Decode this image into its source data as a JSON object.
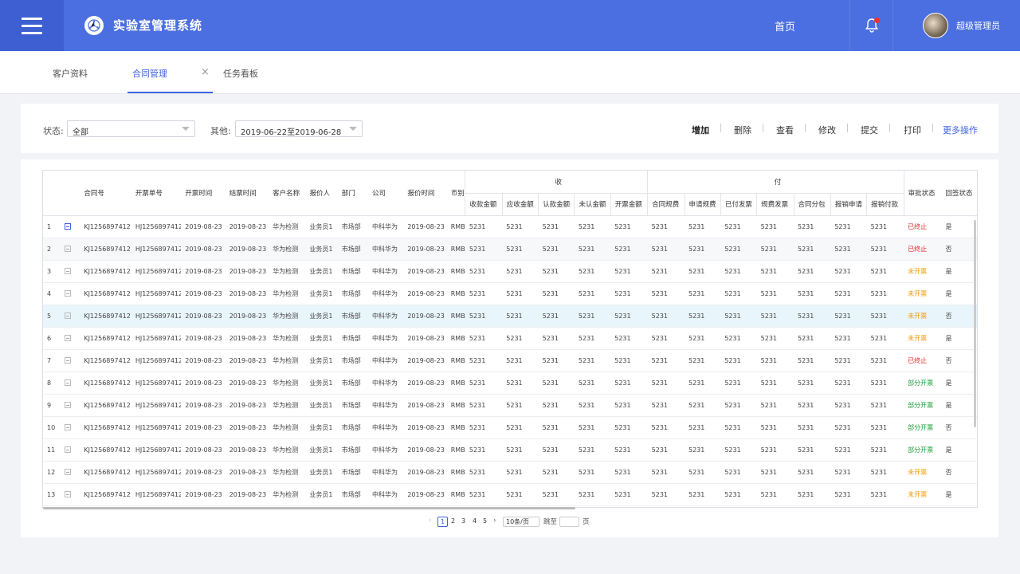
{
  "header": {
    "app_title": "实验室管理系统",
    "home_label": "首页",
    "notification_count": "3",
    "user_name": "超级管理员",
    "accent": "#4b6fe0"
  },
  "tabs": [
    {
      "label": "客户资料"
    },
    {
      "label": "合同管理"
    },
    {
      "label": "任务看板"
    }
  ],
  "filters": {
    "status_label": "状态:",
    "status_value": "全部",
    "other_label": "其他:",
    "date_range": "2019-06-22至2019-06-28"
  },
  "actions": {
    "add": "增加",
    "delete": "删除",
    "view": "查看",
    "edit": "修改",
    "submit": "提交",
    "print": "打印",
    "more": "更多操作"
  },
  "table": {
    "group_receive": "收",
    "group_pay": "付",
    "columns": {
      "contract_no": "合同号",
      "invoice_no": "开票单号",
      "open_time": "开票时间",
      "close_time": "结票时间",
      "customer": "客户名称",
      "reporter": "报价人",
      "dept": "部门",
      "company": "公司",
      "quote_time": "报价时间",
      "currency": "币别",
      "recv_amount": "收款金额",
      "due_amount": "应收金额",
      "confirm_amount": "认款金额",
      "unconfirm_amount": "未认金额",
      "invoice_amount": "开票金额",
      "contract_fee": "合同规费",
      "apply_fee": "申请规费",
      "paid_invoice": "已付发票",
      "fee_invoice": "规费发票",
      "contract_split": "合同分包",
      "reimburse_apply": "报销申请",
      "reimburse_pay": "报销付款",
      "approval": "审批状态",
      "return_status": "回签状态"
    },
    "rows": [
      {
        "n": "1",
        "c1": "KJ1256897412",
        "c2": "HJ1256897412",
        "c3": "2019-08-23",
        "c4": "2019-08-23",
        "c5": "华为检测",
        "c6": "业务员1",
        "c7": "市场部",
        "c8": "中科华为",
        "c9": "2019-08-23",
        "c10": "RMB",
        "v1": "5231",
        "v2": "5231",
        "v3": "5231",
        "v4": "5231",
        "v5": "5231",
        "p1": "5231",
        "p2": "5231",
        "p3": "5231",
        "p4": "5231",
        "p5": "5231",
        "p6": "5231",
        "p7": "5231",
        "status": "已终止",
        "ret": "是"
      },
      {
        "n": "2",
        "c1": "KJ1256897412",
        "c2": "HJ1256897412",
        "c3": "2019-08-23",
        "c4": "2019-08-23",
        "c5": "华为检测",
        "c6": "业务员1",
        "c7": "市场部",
        "c8": "中科华为",
        "c9": "2019-08-23",
        "c10": "RMB",
        "v1": "5231",
        "v2": "5231",
        "v3": "5231",
        "v4": "5231",
        "v5": "5231",
        "p1": "5231",
        "p2": "5231",
        "p3": "5231",
        "p4": "5231",
        "p5": "5231",
        "p6": "5231",
        "p7": "5231",
        "status": "已终止",
        "ret": "否"
      },
      {
        "n": "3",
        "c1": "KJ1256897412",
        "c2": "HJ1256897412",
        "c3": "2019-08-23",
        "c4": "2019-08-23",
        "c5": "华为检测",
        "c6": "业务员1",
        "c7": "市场部",
        "c8": "中科华为",
        "c9": "2019-08-23",
        "c10": "RMB",
        "v1": "5231",
        "v2": "5231",
        "v3": "5231",
        "v4": "5231",
        "v5": "5231",
        "p1": "5231",
        "p2": "5231",
        "p3": "5231",
        "p4": "5231",
        "p5": "5231",
        "p6": "5231",
        "p7": "5231",
        "status": "未开票",
        "ret": "是"
      },
      {
        "n": "4",
        "c1": "KJ1256897412",
        "c2": "HJ1256897412",
        "c3": "2019-08-23",
        "c4": "2019-08-23",
        "c5": "华为检测",
        "c6": "业务员1",
        "c7": "市场部",
        "c8": "中科华为",
        "c9": "2019-08-23",
        "c10": "RMB",
        "v1": "5231",
        "v2": "5231",
        "v3": "5231",
        "v4": "5231",
        "v5": "5231",
        "p1": "5231",
        "p2": "5231",
        "p3": "5231",
        "p4": "5231",
        "p5": "5231",
        "p6": "5231",
        "p7": "5231",
        "status": "未开票",
        "ret": "是"
      },
      {
        "n": "5",
        "c1": "KJ1256897412",
        "c2": "HJ1256897412",
        "c3": "2019-08-23",
        "c4": "2019-08-23",
        "c5": "华为检测",
        "c6": "业务员1",
        "c7": "市场部",
        "c8": "中科华为",
        "c9": "2019-08-23",
        "c10": "RMB",
        "v1": "5231",
        "v2": "5231",
        "v3": "5231",
        "v4": "5231",
        "v5": "5231",
        "p1": "5231",
        "p2": "5231",
        "p3": "5231",
        "p4": "5231",
        "p5": "5231",
        "p6": "5231",
        "p7": "5231",
        "status": "未开票",
        "ret": "否"
      },
      {
        "n": "6",
        "c1": "KJ1256897412",
        "c2": "HJ1256897412",
        "c3": "2019-08-23",
        "c4": "2019-08-23",
        "c5": "华为检测",
        "c6": "业务员1",
        "c7": "市场部",
        "c8": "中科华为",
        "c9": "2019-08-23",
        "c10": "RMB",
        "v1": "5231",
        "v2": "5231",
        "v3": "5231",
        "v4": "5231",
        "v5": "5231",
        "p1": "5231",
        "p2": "5231",
        "p3": "5231",
        "p4": "5231",
        "p5": "5231",
        "p6": "5231",
        "p7": "5231",
        "status": "未开票",
        "ret": "是"
      },
      {
        "n": "7",
        "c1": "KJ1256897412",
        "c2": "HJ1256897412",
        "c3": "2019-08-23",
        "c4": "2019-08-23",
        "c5": "华为检测",
        "c6": "业务员1",
        "c7": "市场部",
        "c8": "中科华为",
        "c9": "2019-08-23",
        "c10": "RMB",
        "v1": "5231",
        "v2": "5231",
        "v3": "5231",
        "v4": "5231",
        "v5": "5231",
        "p1": "5231",
        "p2": "5231",
        "p3": "5231",
        "p4": "5231",
        "p5": "5231",
        "p6": "5231",
        "p7": "5231",
        "status": "已终止",
        "ret": "否"
      },
      {
        "n": "8",
        "c1": "KJ1256897412",
        "c2": "HJ1256897412",
        "c3": "2019-08-23",
        "c4": "2019-08-23",
        "c5": "华为检测",
        "c6": "业务员1",
        "c7": "市场部",
        "c8": "中科华为",
        "c9": "2019-08-23",
        "c10": "RMB",
        "v1": "5231",
        "v2": "5231",
        "v3": "5231",
        "v4": "5231",
        "v5": "5231",
        "p1": "5231",
        "p2": "5231",
        "p3": "5231",
        "p4": "5231",
        "p5": "5231",
        "p6": "5231",
        "p7": "5231",
        "status": "部分开票",
        "ret": "是"
      },
      {
        "n": "9",
        "c1": "KJ1256897412",
        "c2": "HJ1256897412",
        "c3": "2019-08-23",
        "c4": "2019-08-23",
        "c5": "华为检测",
        "c6": "业务员1",
        "c7": "市场部",
        "c8": "中科华为",
        "c9": "2019-08-23",
        "c10": "RMB",
        "v1": "5231",
        "v2": "5231",
        "v3": "5231",
        "v4": "5231",
        "v5": "5231",
        "p1": "5231",
        "p2": "5231",
        "p3": "5231",
        "p4": "5231",
        "p5": "5231",
        "p6": "5231",
        "p7": "5231",
        "status": "部分开票",
        "ret": "是"
      },
      {
        "n": "10",
        "c1": "KJ1256897412",
        "c2": "HJ1256897412",
        "c3": "2019-08-23",
        "c4": "2019-08-23",
        "c5": "华为检测",
        "c6": "业务员1",
        "c7": "市场部",
        "c8": "中科华为",
        "c9": "2019-08-23",
        "c10": "RMB",
        "v1": "5231",
        "v2": "5231",
        "v3": "5231",
        "v4": "5231",
        "v5": "5231",
        "p1": "5231",
        "p2": "5231",
        "p3": "5231",
        "p4": "5231",
        "p5": "5231",
        "p6": "5231",
        "p7": "5231",
        "status": "部分开票",
        "ret": "否"
      },
      {
        "n": "11",
        "c1": "KJ1256897412",
        "c2": "HJ1256897412",
        "c3": "2019-08-23",
        "c4": "2019-08-23",
        "c5": "华为检测",
        "c6": "业务员1",
        "c7": "市场部",
        "c8": "中科华为",
        "c9": "2019-08-23",
        "c10": "RMB",
        "v1": "5231",
        "v2": "5231",
        "v3": "5231",
        "v4": "5231",
        "v5": "5231",
        "p1": "5231",
        "p2": "5231",
        "p3": "5231",
        "p4": "5231",
        "p5": "5231",
        "p6": "5231",
        "p7": "5231",
        "status": "部分开票",
        "ret": "是"
      },
      {
        "n": "12",
        "c1": "KJ1256897412",
        "c2": "HJ1256897412",
        "c3": "2019-08-23",
        "c4": "2019-08-23",
        "c5": "华为检测",
        "c6": "业务员1",
        "c7": "市场部",
        "c8": "中科华为",
        "c9": "2019-08-23",
        "c10": "RMB",
        "v1": "5231",
        "v2": "5231",
        "v3": "5231",
        "v4": "5231",
        "v5": "5231",
        "p1": "5231",
        "p2": "5231",
        "p3": "5231",
        "p4": "5231",
        "p5": "5231",
        "p6": "5231",
        "p7": "5231",
        "status": "未开票",
        "ret": "否"
      },
      {
        "n": "13",
        "c1": "KJ1256897412",
        "c2": "HJ1256897412",
        "c3": "2019-08-23",
        "c4": "2019-08-23",
        "c5": "华为检测",
        "c6": "业务员1",
        "c7": "市场部",
        "c8": "中科华为",
        "c9": "2019-08-23",
        "c10": "RMB",
        "v1": "5231",
        "v2": "5231",
        "v3": "5231",
        "v4": "5231",
        "v5": "5231",
        "p1": "5231",
        "p2": "5231",
        "p3": "5231",
        "p4": "5231",
        "p5": "5231",
        "p6": "5231",
        "p7": "5231",
        "status": "未开票",
        "ret": "是"
      }
    ],
    "status_colors": {
      "已终止": "#e02424",
      "未开票": "#f39a00",
      "部分开票": "#1f9d3a"
    }
  },
  "pagination": {
    "prev": "‹",
    "pages": [
      "1",
      "2",
      "3",
      "4",
      "5"
    ],
    "current": "1",
    "next": "›",
    "page_size": "10条/页",
    "goto_label": "跳至",
    "page_suffix": "页"
  }
}
